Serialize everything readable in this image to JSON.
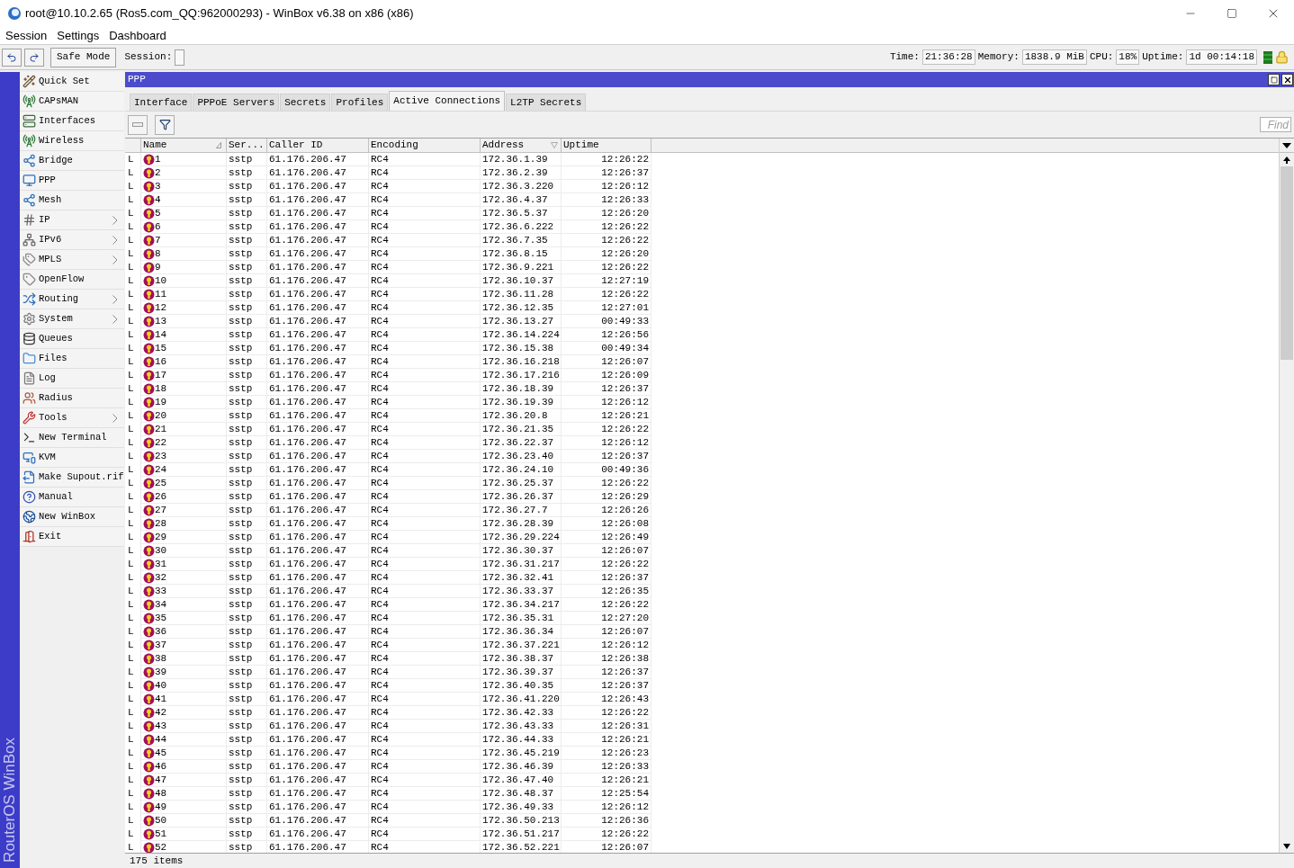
{
  "window": {
    "title": "root@10.10.2.65 (Ros5.com_QQ:962000293) - WinBox v6.38 on x86 (x86)"
  },
  "menu": [
    "Session",
    "Settings",
    "Dashboard"
  ],
  "toolbar": {
    "safe_mode": "Safe Mode",
    "session_label": "Session:",
    "stats": [
      {
        "label": "Time:",
        "value": "21:36:28"
      },
      {
        "label": "Memory:",
        "value": "1838.9 MiB"
      },
      {
        "label": "CPU:",
        "value": "18%"
      },
      {
        "label": "Uptime:",
        "value": "1d 00:14:18"
      }
    ]
  },
  "side_banner": "RouterOS WinBox",
  "sidebar": {
    "items": [
      {
        "label": "Quick Set",
        "submenu": false
      },
      {
        "label": "CAPsMAN",
        "submenu": false
      },
      {
        "label": "Interfaces",
        "submenu": false
      },
      {
        "label": "Wireless",
        "submenu": false
      },
      {
        "label": "Bridge",
        "submenu": false
      },
      {
        "label": "PPP",
        "submenu": false
      },
      {
        "label": "Mesh",
        "submenu": false
      },
      {
        "label": "IP",
        "submenu": true
      },
      {
        "label": "IPv6",
        "submenu": true
      },
      {
        "label": "MPLS",
        "submenu": true
      },
      {
        "label": "OpenFlow",
        "submenu": false
      },
      {
        "label": "Routing",
        "submenu": true
      },
      {
        "label": "System",
        "submenu": true
      },
      {
        "label": "Queues",
        "submenu": false
      },
      {
        "label": "Files",
        "submenu": false
      },
      {
        "label": "Log",
        "submenu": false
      },
      {
        "label": "Radius",
        "submenu": false
      },
      {
        "label": "Tools",
        "submenu": true
      },
      {
        "label": "New Terminal",
        "submenu": false
      },
      {
        "label": "KVM",
        "submenu": false
      },
      {
        "label": "Make Supout.rif",
        "submenu": false
      },
      {
        "label": "Manual",
        "submenu": false
      },
      {
        "label": "New WinBox",
        "submenu": false
      },
      {
        "label": "Exit",
        "submenu": false
      }
    ]
  },
  "ppp_window": {
    "title": "PPP",
    "tabs": [
      {
        "label": "Interface",
        "selected": false
      },
      {
        "label": "PPPoE Servers",
        "selected": false
      },
      {
        "label": "Secrets",
        "selected": false
      },
      {
        "label": "Profiles",
        "selected": false
      },
      {
        "label": "Active Connections",
        "selected": true
      },
      {
        "label": "L2TP Secrets",
        "selected": false
      }
    ],
    "find": {
      "placeholder": "Find"
    },
    "table": {
      "columns": [
        "Name",
        "Ser...",
        "Caller ID",
        "Encoding",
        "Address",
        "Uptime"
      ],
      "rows": [
        {
          "flag": "L",
          "name": "1",
          "service": "sstp",
          "caller_id": "61.176.206.47",
          "encoding": "RC4",
          "address": "172.36.1.39",
          "uptime": "12:26:22"
        },
        {
          "flag": "L",
          "name": "2",
          "service": "sstp",
          "caller_id": "61.176.206.47",
          "encoding": "RC4",
          "address": "172.36.2.39",
          "uptime": "12:26:37"
        },
        {
          "flag": "L",
          "name": "3",
          "service": "sstp",
          "caller_id": "61.176.206.47",
          "encoding": "RC4",
          "address": "172.36.3.220",
          "uptime": "12:26:12"
        },
        {
          "flag": "L",
          "name": "4",
          "service": "sstp",
          "caller_id": "61.176.206.47",
          "encoding": "RC4",
          "address": "172.36.4.37",
          "uptime": "12:26:33"
        },
        {
          "flag": "L",
          "name": "5",
          "service": "sstp",
          "caller_id": "61.176.206.47",
          "encoding": "RC4",
          "address": "172.36.5.37",
          "uptime": "12:26:20"
        },
        {
          "flag": "L",
          "name": "6",
          "service": "sstp",
          "caller_id": "61.176.206.47",
          "encoding": "RC4",
          "address": "172.36.6.222",
          "uptime": "12:26:22"
        },
        {
          "flag": "L",
          "name": "7",
          "service": "sstp",
          "caller_id": "61.176.206.47",
          "encoding": "RC4",
          "address": "172.36.7.35",
          "uptime": "12:26:22"
        },
        {
          "flag": "L",
          "name": "8",
          "service": "sstp",
          "caller_id": "61.176.206.47",
          "encoding": "RC4",
          "address": "172.36.8.15",
          "uptime": "12:26:20"
        },
        {
          "flag": "L",
          "name": "9",
          "service": "sstp",
          "caller_id": "61.176.206.47",
          "encoding": "RC4",
          "address": "172.36.9.221",
          "uptime": "12:26:22"
        },
        {
          "flag": "L",
          "name": "10",
          "service": "sstp",
          "caller_id": "61.176.206.47",
          "encoding": "RC4",
          "address": "172.36.10.37",
          "uptime": "12:27:19"
        },
        {
          "flag": "L",
          "name": "11",
          "service": "sstp",
          "caller_id": "61.176.206.47",
          "encoding": "RC4",
          "address": "172.36.11.28",
          "uptime": "12:26:22"
        },
        {
          "flag": "L",
          "name": "12",
          "service": "sstp",
          "caller_id": "61.176.206.47",
          "encoding": "RC4",
          "address": "172.36.12.35",
          "uptime": "12:27:01"
        },
        {
          "flag": "L",
          "name": "13",
          "service": "sstp",
          "caller_id": "61.176.206.47",
          "encoding": "RC4",
          "address": "172.36.13.27",
          "uptime": "00:49:33"
        },
        {
          "flag": "L",
          "name": "14",
          "service": "sstp",
          "caller_id": "61.176.206.47",
          "encoding": "RC4",
          "address": "172.36.14.224",
          "uptime": "12:26:56"
        },
        {
          "flag": "L",
          "name": "15",
          "service": "sstp",
          "caller_id": "61.176.206.47",
          "encoding": "RC4",
          "address": "172.36.15.38",
          "uptime": "00:49:34"
        },
        {
          "flag": "L",
          "name": "16",
          "service": "sstp",
          "caller_id": "61.176.206.47",
          "encoding": "RC4",
          "address": "172.36.16.218",
          "uptime": "12:26:07"
        },
        {
          "flag": "L",
          "name": "17",
          "service": "sstp",
          "caller_id": "61.176.206.47",
          "encoding": "RC4",
          "address": "172.36.17.216",
          "uptime": "12:26:09"
        },
        {
          "flag": "L",
          "name": "18",
          "service": "sstp",
          "caller_id": "61.176.206.47",
          "encoding": "RC4",
          "address": "172.36.18.39",
          "uptime": "12:26:37"
        },
        {
          "flag": "L",
          "name": "19",
          "service": "sstp",
          "caller_id": "61.176.206.47",
          "encoding": "RC4",
          "address": "172.36.19.39",
          "uptime": "12:26:12"
        },
        {
          "flag": "L",
          "name": "20",
          "service": "sstp",
          "caller_id": "61.176.206.47",
          "encoding": "RC4",
          "address": "172.36.20.8",
          "uptime": "12:26:21"
        },
        {
          "flag": "L",
          "name": "21",
          "service": "sstp",
          "caller_id": "61.176.206.47",
          "encoding": "RC4",
          "address": "172.36.21.35",
          "uptime": "12:26:22"
        },
        {
          "flag": "L",
          "name": "22",
          "service": "sstp",
          "caller_id": "61.176.206.47",
          "encoding": "RC4",
          "address": "172.36.22.37",
          "uptime": "12:26:12"
        },
        {
          "flag": "L",
          "name": "23",
          "service": "sstp",
          "caller_id": "61.176.206.47",
          "encoding": "RC4",
          "address": "172.36.23.40",
          "uptime": "12:26:37"
        },
        {
          "flag": "L",
          "name": "24",
          "service": "sstp",
          "caller_id": "61.176.206.47",
          "encoding": "RC4",
          "address": "172.36.24.10",
          "uptime": "00:49:36"
        },
        {
          "flag": "L",
          "name": "25",
          "service": "sstp",
          "caller_id": "61.176.206.47",
          "encoding": "RC4",
          "address": "172.36.25.37",
          "uptime": "12:26:22"
        },
        {
          "flag": "L",
          "name": "26",
          "service": "sstp",
          "caller_id": "61.176.206.47",
          "encoding": "RC4",
          "address": "172.36.26.37",
          "uptime": "12:26:29"
        },
        {
          "flag": "L",
          "name": "27",
          "service": "sstp",
          "caller_id": "61.176.206.47",
          "encoding": "RC4",
          "address": "172.36.27.7",
          "uptime": "12:26:26"
        },
        {
          "flag": "L",
          "name": "28",
          "service": "sstp",
          "caller_id": "61.176.206.47",
          "encoding": "RC4",
          "address": "172.36.28.39",
          "uptime": "12:26:08"
        },
        {
          "flag": "L",
          "name": "29",
          "service": "sstp",
          "caller_id": "61.176.206.47",
          "encoding": "RC4",
          "address": "172.36.29.224",
          "uptime": "12:26:49"
        },
        {
          "flag": "L",
          "name": "30",
          "service": "sstp",
          "caller_id": "61.176.206.47",
          "encoding": "RC4",
          "address": "172.36.30.37",
          "uptime": "12:26:07"
        },
        {
          "flag": "L",
          "name": "31",
          "service": "sstp",
          "caller_id": "61.176.206.47",
          "encoding": "RC4",
          "address": "172.36.31.217",
          "uptime": "12:26:22"
        },
        {
          "flag": "L",
          "name": "32",
          "service": "sstp",
          "caller_id": "61.176.206.47",
          "encoding": "RC4",
          "address": "172.36.32.41",
          "uptime": "12:26:37"
        },
        {
          "flag": "L",
          "name": "33",
          "service": "sstp",
          "caller_id": "61.176.206.47",
          "encoding": "RC4",
          "address": "172.36.33.37",
          "uptime": "12:26:35"
        },
        {
          "flag": "L",
          "name": "34",
          "service": "sstp",
          "caller_id": "61.176.206.47",
          "encoding": "RC4",
          "address": "172.36.34.217",
          "uptime": "12:26:22"
        },
        {
          "flag": "L",
          "name": "35",
          "service": "sstp",
          "caller_id": "61.176.206.47",
          "encoding": "RC4",
          "address": "172.36.35.31",
          "uptime": "12:27:20"
        },
        {
          "flag": "L",
          "name": "36",
          "service": "sstp",
          "caller_id": "61.176.206.47",
          "encoding": "RC4",
          "address": "172.36.36.34",
          "uptime": "12:26:07"
        },
        {
          "flag": "L",
          "name": "37",
          "service": "sstp",
          "caller_id": "61.176.206.47",
          "encoding": "RC4",
          "address": "172.36.37.221",
          "uptime": "12:26:12"
        },
        {
          "flag": "L",
          "name": "38",
          "service": "sstp",
          "caller_id": "61.176.206.47",
          "encoding": "RC4",
          "address": "172.36.38.37",
          "uptime": "12:26:38"
        },
        {
          "flag": "L",
          "name": "39",
          "service": "sstp",
          "caller_id": "61.176.206.47",
          "encoding": "RC4",
          "address": "172.36.39.37",
          "uptime": "12:26:37"
        },
        {
          "flag": "L",
          "name": "40",
          "service": "sstp",
          "caller_id": "61.176.206.47",
          "encoding": "RC4",
          "address": "172.36.40.35",
          "uptime": "12:26:37"
        },
        {
          "flag": "L",
          "name": "41",
          "service": "sstp",
          "caller_id": "61.176.206.47",
          "encoding": "RC4",
          "address": "172.36.41.220",
          "uptime": "12:26:43"
        },
        {
          "flag": "L",
          "name": "42",
          "service": "sstp",
          "caller_id": "61.176.206.47",
          "encoding": "RC4",
          "address": "172.36.42.33",
          "uptime": "12:26:22"
        },
        {
          "flag": "L",
          "name": "43",
          "service": "sstp",
          "caller_id": "61.176.206.47",
          "encoding": "RC4",
          "address": "172.36.43.33",
          "uptime": "12:26:31"
        },
        {
          "flag": "L",
          "name": "44",
          "service": "sstp",
          "caller_id": "61.176.206.47",
          "encoding": "RC4",
          "address": "172.36.44.33",
          "uptime": "12:26:21"
        },
        {
          "flag": "L",
          "name": "45",
          "service": "sstp",
          "caller_id": "61.176.206.47",
          "encoding": "RC4",
          "address": "172.36.45.219",
          "uptime": "12:26:23"
        },
        {
          "flag": "L",
          "name": "46",
          "service": "sstp",
          "caller_id": "61.176.206.47",
          "encoding": "RC4",
          "address": "172.36.46.39",
          "uptime": "12:26:33"
        },
        {
          "flag": "L",
          "name": "47",
          "service": "sstp",
          "caller_id": "61.176.206.47",
          "encoding": "RC4",
          "address": "172.36.47.40",
          "uptime": "12:26:21"
        },
        {
          "flag": "L",
          "name": "48",
          "service": "sstp",
          "caller_id": "61.176.206.47",
          "encoding": "RC4",
          "address": "172.36.48.37",
          "uptime": "12:25:54"
        },
        {
          "flag": "L",
          "name": "49",
          "service": "sstp",
          "caller_id": "61.176.206.47",
          "encoding": "RC4",
          "address": "172.36.49.33",
          "uptime": "12:26:12"
        },
        {
          "flag": "L",
          "name": "50",
          "service": "sstp",
          "caller_id": "61.176.206.47",
          "encoding": "RC4",
          "address": "172.36.50.213",
          "uptime": "12:26:36"
        },
        {
          "flag": "L",
          "name": "51",
          "service": "sstp",
          "caller_id": "61.176.206.47",
          "encoding": "RC4",
          "address": "172.36.51.217",
          "uptime": "12:26:22"
        },
        {
          "flag": "L",
          "name": "52",
          "service": "sstp",
          "caller_id": "61.176.206.47",
          "encoding": "RC4",
          "address": "172.36.52.221",
          "uptime": "12:26:07"
        }
      ]
    },
    "status_bar": "175 items"
  }
}
